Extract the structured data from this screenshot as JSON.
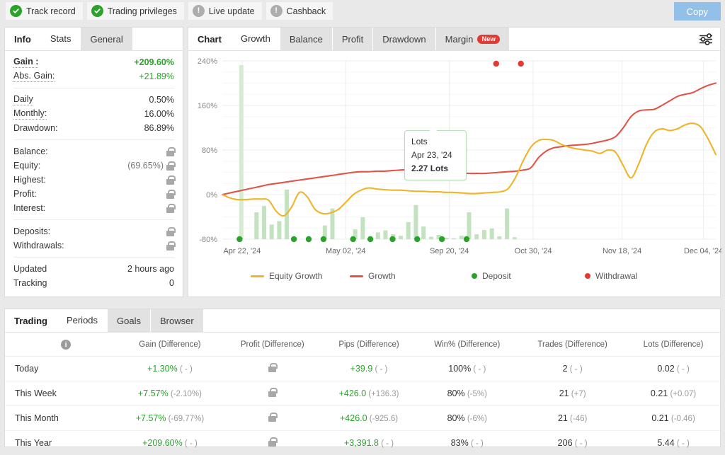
{
  "header": {
    "badges": [
      {
        "label": "Track record",
        "icon": "check-circle-icon",
        "state": "ok"
      },
      {
        "label": "Trading privileges",
        "icon": "check-circle-icon",
        "state": "ok"
      },
      {
        "label": "Live update",
        "icon": "exclamation-circle-icon",
        "state": "warn"
      },
      {
        "label": "Cashback",
        "icon": "exclamation-circle-icon",
        "state": "warn"
      }
    ],
    "copy_label": "Copy"
  },
  "left_panel": {
    "tabs": [
      {
        "label": "Info",
        "style": "plain"
      },
      {
        "label": "Stats",
        "style": "active"
      },
      {
        "label": "General",
        "style": "inactive"
      }
    ],
    "groups": [
      {
        "rows": [
          {
            "label": "Gain :",
            "value": "+209.60%",
            "value_class": "greenb",
            "label_class": "dash b",
            "lock": false
          },
          {
            "label": "Abs. Gain:",
            "value": "+21.89%",
            "value_class": "green",
            "label_class": "dash",
            "lock": false
          }
        ]
      },
      {
        "rows": [
          {
            "label": "Daily",
            "value": "0.50%",
            "value_class": "",
            "label_class": "dash",
            "lock": false
          },
          {
            "label": "Monthly:",
            "value": "16.00%",
            "value_class": "",
            "label_class": "dash",
            "lock": false
          },
          {
            "label": "Drawdown:",
            "value": "86.89%",
            "value_class": "",
            "label_class": "",
            "lock": false
          }
        ]
      },
      {
        "rows": [
          {
            "label": "Balance:",
            "value": "",
            "value_class": "",
            "label_class": "",
            "lock": true
          },
          {
            "label": "Equity:",
            "value": "(69.65%)",
            "value_class": "sub",
            "label_class": "",
            "lock": true
          },
          {
            "label": "Highest:",
            "value": "",
            "value_class": "",
            "label_class": "",
            "lock": true
          },
          {
            "label": "Profit:",
            "value": "",
            "value_class": "",
            "label_class": "",
            "lock": true
          },
          {
            "label": "Interest:",
            "value": "",
            "value_class": "",
            "label_class": "",
            "lock": true
          }
        ]
      },
      {
        "rows": [
          {
            "label": "Deposits:",
            "value": "",
            "value_class": "",
            "label_class": "",
            "lock": true
          },
          {
            "label": "Withdrawals:",
            "value": "",
            "value_class": "",
            "label_class": "",
            "lock": true
          }
        ]
      },
      {
        "rows": [
          {
            "label": "Updated",
            "value": "2 hours ago",
            "value_class": "",
            "label_class": "",
            "lock": false
          },
          {
            "label": "Tracking",
            "value": "0",
            "value_class": "",
            "label_class": "",
            "lock": false
          }
        ]
      }
    ]
  },
  "chart_panel": {
    "tabs": [
      {
        "label": "Chart",
        "style": "plain"
      },
      {
        "label": "Growth",
        "style": "active"
      },
      {
        "label": "Balance",
        "style": "inactive"
      },
      {
        "label": "Profit",
        "style": "inactive"
      },
      {
        "label": "Drawdown",
        "style": "inactive"
      },
      {
        "label": "Margin",
        "style": "inactive",
        "pill": "New"
      }
    ],
    "settings_icon": "sliders-icon",
    "tooltip": {
      "title": "Lots",
      "date": "Apr 23, '24",
      "value": "2.27 Lots"
    }
  },
  "chart_data": {
    "type": "line",
    "title": "",
    "xlabel": "",
    "ylabel": "",
    "ylim": [
      -80,
      240
    ],
    "yticks": [
      "240%",
      "160%",
      "80%",
      "0%",
      "-80%"
    ],
    "ytick_values": [
      240,
      160,
      80,
      0,
      -80
    ],
    "xticks": [
      "Apr 22, '24",
      "May 02, '24",
      "Sep 20, '24",
      "Oct 30, '24",
      "Nov 18, '24",
      "Dec 04, '24"
    ],
    "xtick_positions": [
      0.04,
      0.25,
      0.46,
      0.63,
      0.81,
      0.975
    ],
    "grid": true,
    "legend_position": "bottom",
    "legend": [
      {
        "name": "Equity Growth",
        "color": "#f0b429",
        "type": "line"
      },
      {
        "name": "Growth",
        "color": "#e0544a",
        "type": "line"
      },
      {
        "name": "Deposit",
        "color": "#2aa32a",
        "type": "dot"
      },
      {
        "name": "Withdrawal",
        "color": "#e03b35",
        "type": "dot"
      }
    ],
    "series": [
      {
        "name": "Equity Growth",
        "color": "#f0b429",
        "values": [
          0,
          -6,
          -9,
          -9,
          -8,
          -8,
          -10,
          -30,
          -38,
          -22,
          4,
          -4,
          -26,
          -34,
          -33,
          -27,
          -14,
          0,
          8,
          12,
          10,
          9,
          8,
          8,
          7,
          6,
          6,
          5,
          5,
          4,
          4,
          3,
          2,
          2,
          3,
          4,
          5,
          10,
          30,
          60,
          85,
          97,
          99,
          97,
          90,
          85,
          82,
          80,
          78,
          74,
          80,
          76,
          52,
          30,
          55,
          90,
          112,
          118,
          115,
          118,
          125,
          128,
          122,
          100,
          72
        ]
      },
      {
        "name": "Growth",
        "color": "#e0544a",
        "values": [
          0,
          3,
          6,
          9,
          12,
          15,
          18,
          20,
          22,
          24,
          26,
          28,
          30,
          32,
          34,
          36,
          38,
          40,
          41,
          41,
          42,
          42,
          43,
          44,
          45,
          47,
          49,
          52,
          54,
          56,
          53,
          40,
          38,
          38,
          38,
          39,
          40,
          41,
          42,
          44,
          48,
          66,
          78,
          84,
          86,
          88,
          89,
          90,
          92,
          95,
          98,
          104,
          120,
          140,
          150,
          152,
          153,
          160,
          168,
          176,
          180,
          183,
          190,
          196,
          200
        ]
      }
    ],
    "bars": {
      "name": "Lots",
      "color": "#c3e2c0",
      "values": [
        0,
        0,
        2.27,
        0,
        0.55,
        0.68,
        0.3,
        0.37,
        1.02,
        0.04,
        0,
        0,
        0,
        0.28,
        0.63,
        0,
        0,
        0.2,
        0.45,
        0,
        0.14,
        0.18,
        0.1,
        0.07,
        0.35,
        0.7,
        0.26,
        0.05,
        0.09,
        0.03,
        0.02,
        0.07,
        0.55,
        0.1,
        0.19,
        0.22,
        0.06,
        0.63,
        0.04,
        0,
        0,
        0,
        0,
        0,
        0,
        0,
        0,
        0,
        0,
        0,
        0,
        0,
        0,
        0,
        0,
        0,
        0,
        0,
        0,
        0,
        0,
        0,
        0,
        0,
        0
      ],
      "max": 2.27,
      "highlighted_index": 2
    },
    "deposits": [
      0.035,
      0.145,
      0.175,
      0.205,
      0.265,
      0.3,
      0.345,
      0.395,
      0.445,
      0.495
    ],
    "withdrawals": [
      0.555,
      0.605
    ]
  },
  "bottom_panel": {
    "tabs": [
      {
        "label": "Trading",
        "style": "plain"
      },
      {
        "label": "Periods",
        "style": "active"
      },
      {
        "label": "Goals",
        "style": "inactive"
      },
      {
        "label": "Browser",
        "style": "inactive"
      }
    ],
    "columns": [
      {
        "label": "",
        "icon": "info-icon"
      },
      {
        "label": "Gain (Difference)"
      },
      {
        "label": "Profit (Difference)"
      },
      {
        "label": "Pips (Difference)"
      },
      {
        "label": "Win% (Difference)"
      },
      {
        "label": "Trades (Difference)"
      },
      {
        "label": "Lots (Difference)"
      }
    ],
    "rows": [
      {
        "period": "Today",
        "gain": "+1.30%",
        "gain_diff": "( - )",
        "profit_locked": true,
        "pips": "+39.9",
        "pips_diff": "( - )",
        "win": "100%",
        "win_diff": "( - )",
        "trades": "2",
        "trades_diff": "( - )",
        "lots": "0.02",
        "lots_diff": "( - )"
      },
      {
        "period": "This Week",
        "gain": "+7.57%",
        "gain_diff": "(-2.10%)",
        "profit_locked": true,
        "pips": "+426.0",
        "pips_diff": "(+136.3)",
        "win": "80%",
        "win_diff": "(-5%)",
        "trades": "21",
        "trades_diff": "(+7)",
        "lots": "0.21",
        "lots_diff": "(+0.07)"
      },
      {
        "period": "This Month",
        "gain": "+7.57%",
        "gain_diff": "(-69.77%)",
        "profit_locked": true,
        "pips": "+426.0",
        "pips_diff": "(-925.6)",
        "win": "80%",
        "win_diff": "(-6%)",
        "trades": "21",
        "trades_diff": "(-46)",
        "lots": "0.21",
        "lots_diff": "(-0.46)"
      },
      {
        "period": "This Year",
        "gain": "+209.60%",
        "gain_diff": "( - )",
        "profit_locked": true,
        "pips": "+3,391.8",
        "pips_diff": "( - )",
        "win": "83%",
        "win_diff": "( - )",
        "trades": "206",
        "trades_diff": "( - )",
        "lots": "5.44",
        "lots_diff": "( - )"
      }
    ]
  }
}
